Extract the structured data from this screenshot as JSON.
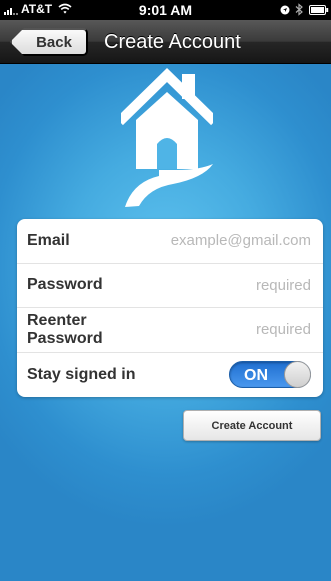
{
  "status_bar": {
    "carrier": "AT&T",
    "time": "9:01 AM",
    "icons": [
      "signal-icon",
      "wifi-icon",
      "location-icon",
      "bluetooth-icon",
      "battery-icon"
    ]
  },
  "nav": {
    "back_label": "Back",
    "title": "Create Account"
  },
  "logo": {
    "icon": "house-path-icon"
  },
  "form": {
    "email": {
      "label": "Email",
      "placeholder": "example@gmail.com",
      "value": ""
    },
    "password": {
      "label": "Password",
      "placeholder": "required",
      "value": ""
    },
    "reenter_password": {
      "label": "Reenter Password",
      "placeholder": "required",
      "value": ""
    },
    "stay_signed_in": {
      "label": "Stay signed in",
      "state": "ON"
    }
  },
  "actions": {
    "create_account_label": "Create Account"
  },
  "colors": {
    "background": "#45abe0",
    "nav_bar": "#262626",
    "toggle_on": "#2f7fde",
    "card": "#ffffff"
  }
}
